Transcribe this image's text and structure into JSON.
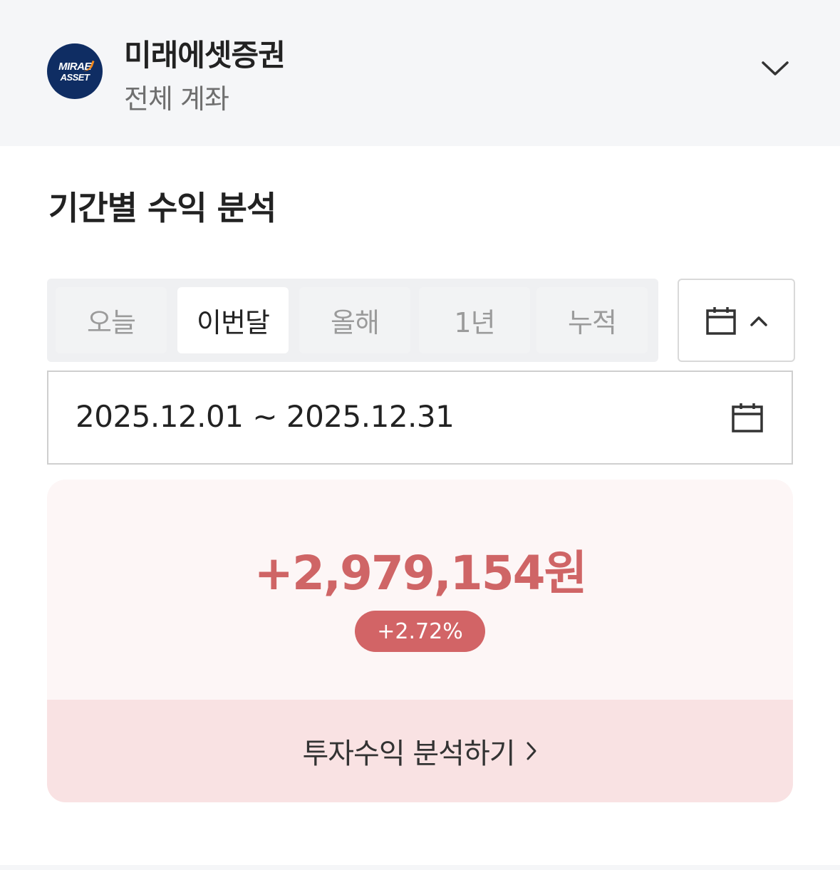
{
  "header": {
    "logo": {
      "line1": "MIRAE",
      "line2": "ASSET"
    },
    "broker_name": "미래에셋증권",
    "account_scope": "전체 계좌",
    "expand_icon": "chevron-down-icon"
  },
  "section": {
    "title": "기간별 수익 분석"
  },
  "period_tabs": {
    "items": [
      {
        "label": "오늘"
      },
      {
        "label": "이번달",
        "active": true
      },
      {
        "label": "올해"
      },
      {
        "label": "1년"
      },
      {
        "label": "누적"
      }
    ],
    "calendar_toggle_icon": "calendar-icon",
    "collapse_icon": "chevron-up-icon"
  },
  "date_range": {
    "text": "2025.12.01 ~ 2025.12.31",
    "icon": "calendar-icon"
  },
  "result": {
    "profit_amount": "+2,979,154원",
    "profit_rate": "+2.72%",
    "link_label": "투자수익 분석하기",
    "link_icon": "chevron-right-icon"
  },
  "colors": {
    "profit": "#cf6566",
    "badge": "#d26466",
    "card_bg": "#fdf6f6",
    "link_bg": "#f9e2e3",
    "logo_bg": "#0f2d63"
  }
}
